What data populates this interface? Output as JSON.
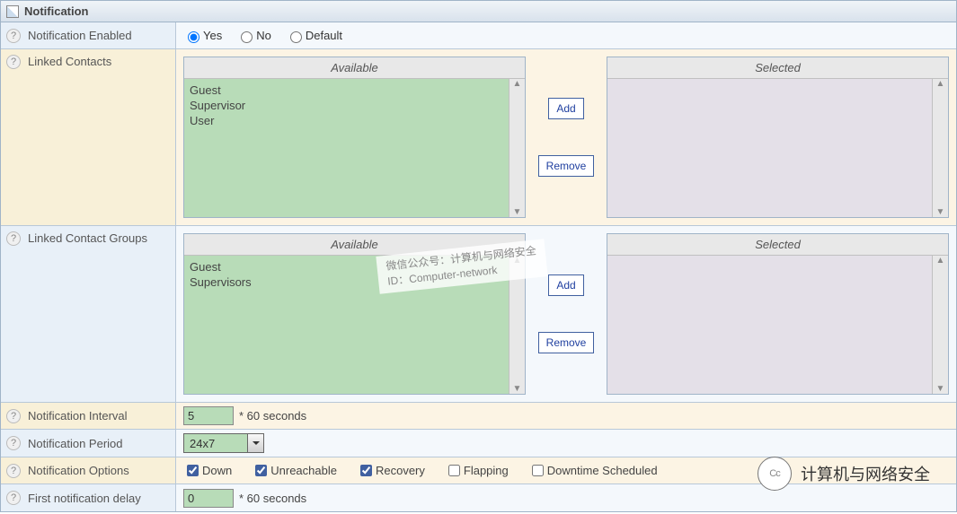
{
  "panel": {
    "title": "Notification"
  },
  "rows": {
    "enabled": {
      "label": "Notification Enabled",
      "options": {
        "yes": "Yes",
        "no": "No",
        "default": "Default"
      },
      "value": "yes"
    },
    "contacts": {
      "label": "Linked Contacts",
      "available_header": "Available",
      "selected_header": "Selected",
      "available": [
        "Guest",
        "Supervisor",
        "User"
      ],
      "selected": [],
      "add": "Add",
      "remove": "Remove"
    },
    "groups": {
      "label": "Linked Contact Groups",
      "available_header": "Available",
      "selected_header": "Selected",
      "available": [
        "Guest",
        "Supervisors"
      ],
      "selected": [],
      "add": "Add",
      "remove": "Remove"
    },
    "interval": {
      "label": "Notification Interval",
      "value": "5",
      "unit": "* 60 seconds"
    },
    "period": {
      "label": "Notification Period",
      "value": "24x7"
    },
    "options": {
      "label": "Notification Options",
      "items": [
        {
          "label": "Down",
          "checked": true
        },
        {
          "label": "Unreachable",
          "checked": true
        },
        {
          "label": "Recovery",
          "checked": true
        },
        {
          "label": "Flapping",
          "checked": false
        },
        {
          "label": "Downtime Scheduled",
          "checked": false
        }
      ]
    },
    "first_delay": {
      "label": "First notification delay",
      "value": "0",
      "unit": "* 60 seconds"
    }
  },
  "watermark": {
    "line1": "微信公众号：计算机与网络安全",
    "line2": "ID：Computer-network"
  },
  "brand": {
    "label": "计算机与网络安全",
    "circle": "Cc"
  }
}
